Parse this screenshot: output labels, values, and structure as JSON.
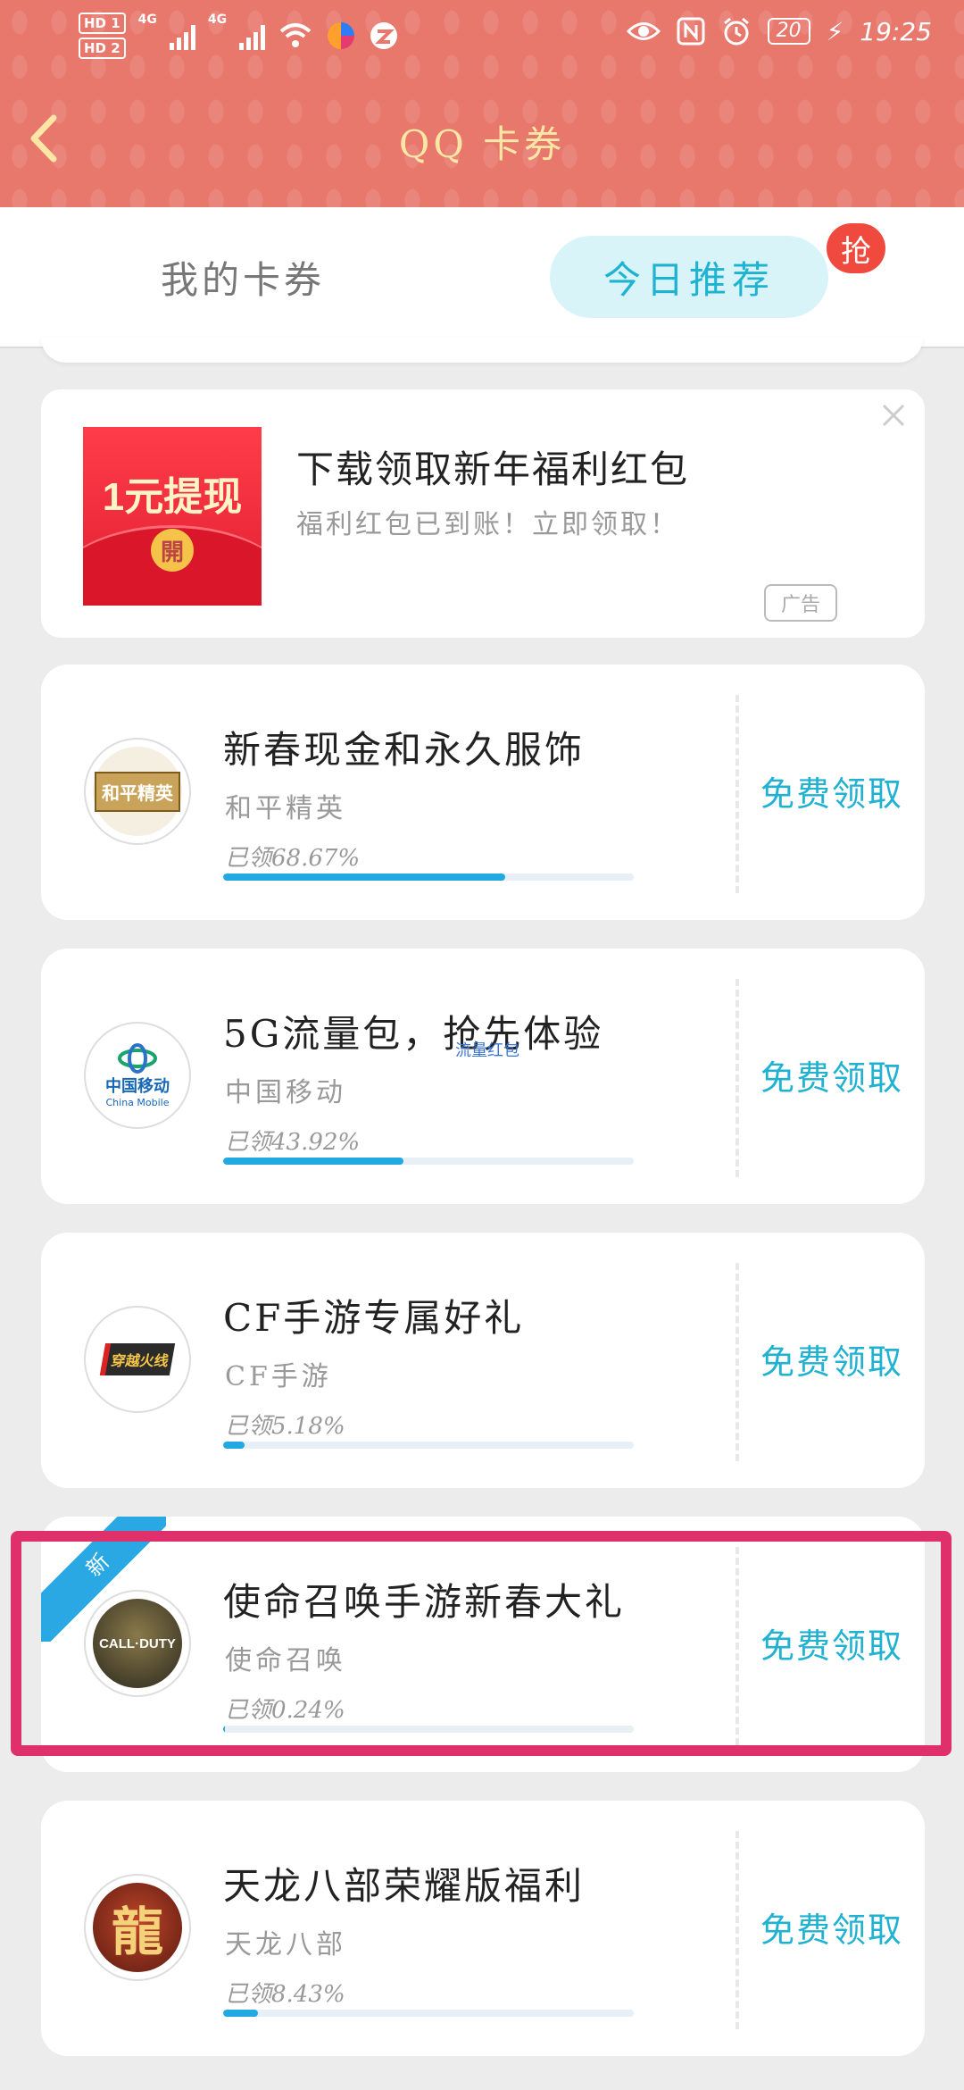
{
  "status_bar": {
    "hd1": "HD 1",
    "hd2": "HD 2",
    "sig1": "4G",
    "sig2": "4G",
    "battery": "20",
    "time": "19:25"
  },
  "header": {
    "title": "QQ 卡券"
  },
  "tabs": {
    "mine": "我的卡券",
    "today": "今日推荐",
    "badge": "抢"
  },
  "ad": {
    "image_text": "1元提现",
    "image_coin": "開",
    "title": "下载领取新年福利红包",
    "subtitle": "福利红包已到账！立即领取！",
    "tag": "广告"
  },
  "floating_text": "流量红包",
  "cards": [
    {
      "title": "新春现金和永久服饰",
      "sub": "和平精英",
      "pct_label": "已领68.67%",
      "progress": 0.6867,
      "claim": "免费领取",
      "logo_text": "和平精英",
      "logo_bg": "#c9a35a"
    },
    {
      "title": "5G流量包，抢先体验",
      "sub": "中国移动",
      "pct_label": "已领43.92%",
      "progress": 0.4392,
      "claim": "免费领取",
      "logo_text": "中国移动",
      "logo_text2": "China Mobile",
      "logo_bg": "#ffffff"
    },
    {
      "title": "CF手游专属好礼",
      "sub": "CF手游",
      "pct_label": "已领5.18%",
      "progress": 0.0518,
      "claim": "免费领取",
      "logo_text": "穿越火线",
      "logo_bg": "#ffffff"
    },
    {
      "title": "使命召唤手游新春大礼",
      "sub": "使命召唤",
      "pct_label": "已领0.24%",
      "progress": 0.0024,
      "claim": "免费领取",
      "ribbon": "新",
      "logo_text": "CALL·DUTY",
      "logo_bg": "#3a3a2c"
    },
    {
      "title": "天龙八部荣耀版福利",
      "sub": "天龙八部",
      "pct_label": "已领8.43%",
      "progress": 0.0843,
      "claim": "免费领取",
      "logo_text": "龍",
      "logo_bg": "#8a2b1c"
    }
  ],
  "colors": {
    "header_bg": "#e8776c",
    "title_color": "#fbe6a6",
    "accent": "#21b2d1",
    "progress": "#22a9e2",
    "highlight": "#e0306b"
  }
}
